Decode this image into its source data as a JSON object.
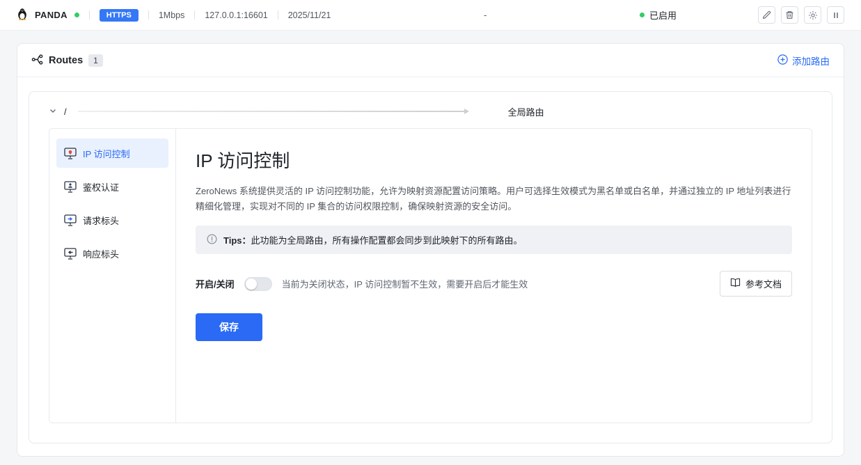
{
  "header": {
    "brand": "PANDA",
    "protocol": "HTTPS",
    "bandwidth": "1Mbps",
    "address": "127.0.0.1:16601",
    "date": "2025/11/21",
    "center_text": "-",
    "status": "已启用"
  },
  "routes_bar": {
    "title": "Routes",
    "count": "1",
    "add_route": "添加路由"
  },
  "route": {
    "path": "/",
    "name": "全局路由"
  },
  "sidebar": {
    "items": [
      {
        "label": "IP 访问控制"
      },
      {
        "label": "鉴权认证"
      },
      {
        "label": "请求标头"
      },
      {
        "label": "响应标头"
      }
    ]
  },
  "panel": {
    "title": "IP 访问控制",
    "description": "ZeroNews 系统提供灵活的 IP 访问控制功能，允许为映射资源配置访问策略。用户可选择生效模式为黑名单或白名单，并通过独立的 IP 地址列表进行精细化管理，实现对不同的 IP 集合的访问权限控制，确保映射资源的安全访问。",
    "tips_label": "Tips：",
    "tips_text": "此功能为全局路由，所有操作配置都会同步到此映射下的所有路由。",
    "toggle_label": "开启/关闭",
    "toggle_hint": "当前为关闭状态，IP 访问控制暂不生效，需要开启后才能生效",
    "doc_button": "参考文档",
    "save_button": "保存"
  },
  "colors": {
    "accent": "#2a6af5",
    "status_green": "#2fce65"
  }
}
